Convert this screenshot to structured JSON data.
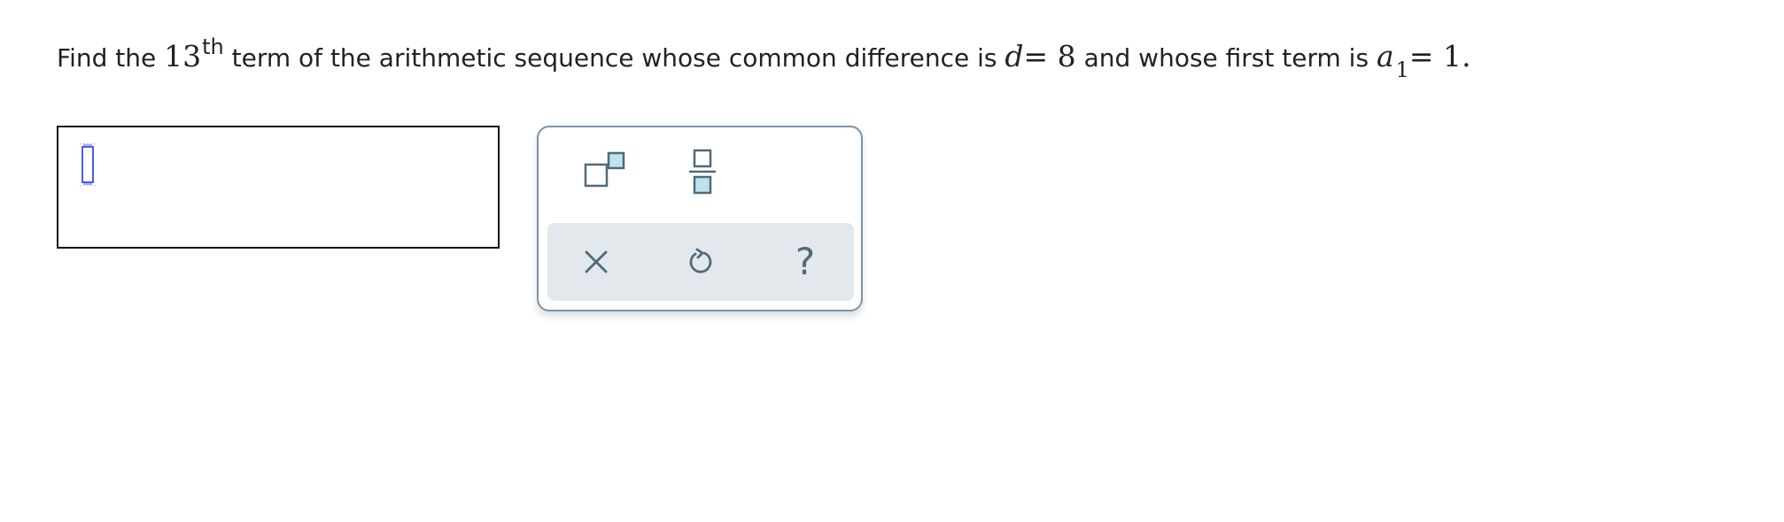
{
  "question": {
    "prefix": "Find the ",
    "term_number": "13",
    "term_suffix": "th",
    "middle": " term of the arithmetic sequence whose common difference is ",
    "diff_symbol": "d",
    "diff_equals": "= 8",
    "connector": " and whose first term is ",
    "first_term_symbol": "a",
    "first_term_subscript": "1",
    "first_term_equals": "= 1",
    "end": "."
  },
  "answer": {
    "value": ""
  },
  "toolbar": {
    "tools": [
      {
        "icon": "superscript-icon"
      },
      {
        "icon": "fraction-icon"
      }
    ],
    "actions": [
      {
        "icon": "clear-icon"
      },
      {
        "icon": "undo-icon"
      },
      {
        "icon": "help-icon",
        "glyph": "?"
      }
    ]
  },
  "colors": {
    "toolbar_border": "#7c93a6",
    "action_bg": "#e2e8eb",
    "icon_slate": "#4f6b7c",
    "icon_fill": "#bfe3ea",
    "cursor_blue": "#4e5de0"
  }
}
